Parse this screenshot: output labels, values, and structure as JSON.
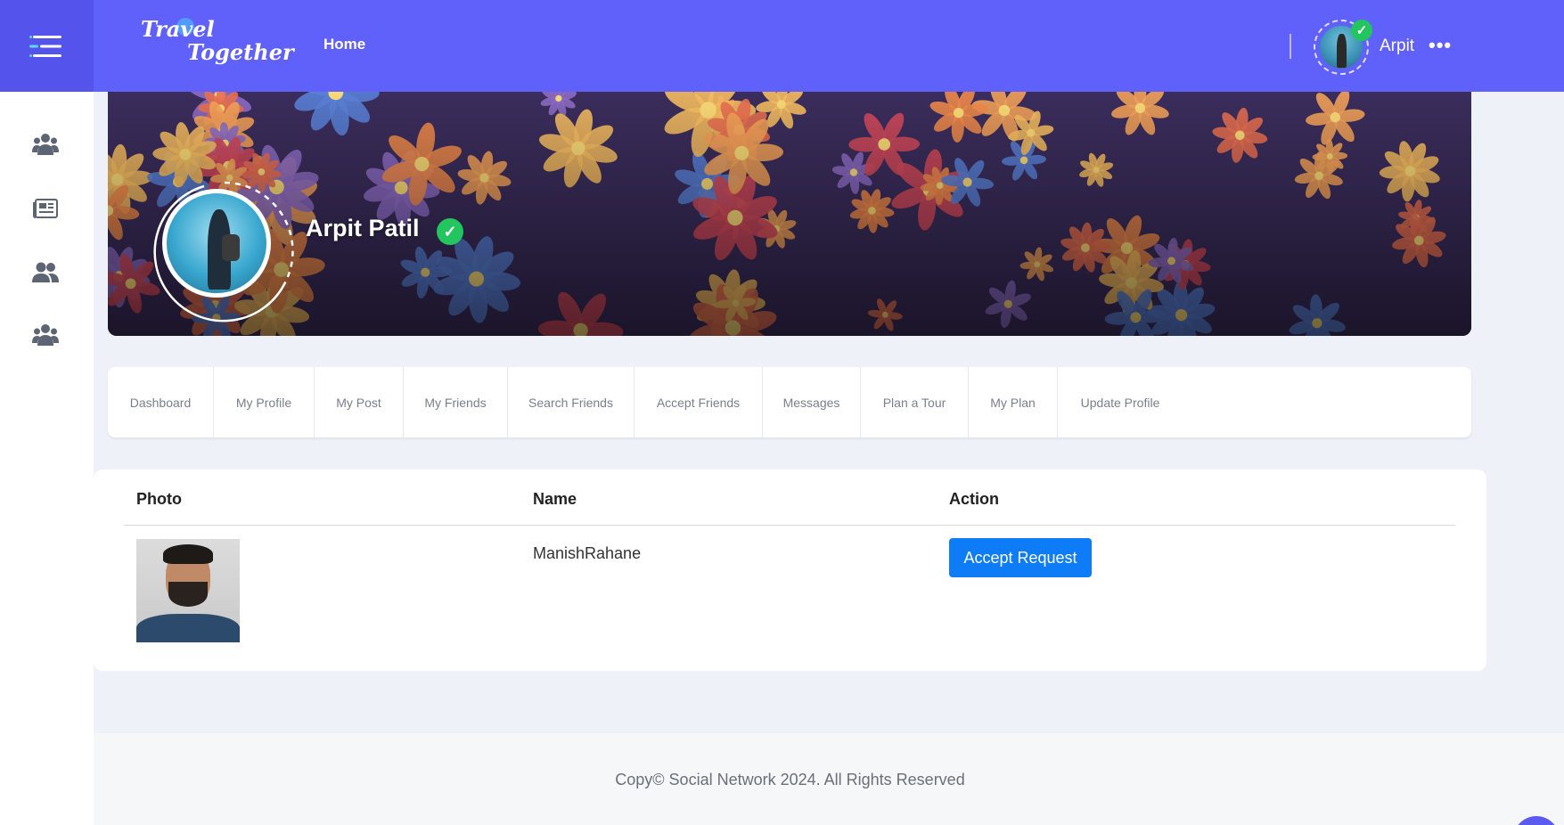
{
  "header": {
    "logo_line1": "Travel",
    "logo_line2": "Together",
    "nav_home": "Home",
    "user_name": "Arpit",
    "more_icon": "•••"
  },
  "sidebar": {
    "items": [
      {
        "icon": "groups-icon"
      },
      {
        "icon": "newspaper-icon"
      },
      {
        "icon": "friends-icon"
      },
      {
        "icon": "community-icon"
      }
    ]
  },
  "profile": {
    "name": "Arpit Patil",
    "verified_icon": "✓"
  },
  "tabs": [
    {
      "label": "Dashboard"
    },
    {
      "label": "My Profile"
    },
    {
      "label": "My Post"
    },
    {
      "label": "My Friends"
    },
    {
      "label": "Search Friends"
    },
    {
      "label": "Accept Friends"
    },
    {
      "label": "Messages"
    },
    {
      "label": "Plan a Tour"
    },
    {
      "label": "My Plan"
    },
    {
      "label": "Update Profile"
    }
  ],
  "table": {
    "columns": [
      "Photo",
      "Name",
      "Action"
    ],
    "rows": [
      {
        "name": "ManishRahane",
        "action_label": "Accept Request"
      }
    ]
  },
  "footer": {
    "text": "Copy© Social Network 2024. All Rights Reserved"
  },
  "colors": {
    "header_bg": "#6060fb",
    "accent_button": "#0d7cf6",
    "verified": "#22c55e"
  }
}
